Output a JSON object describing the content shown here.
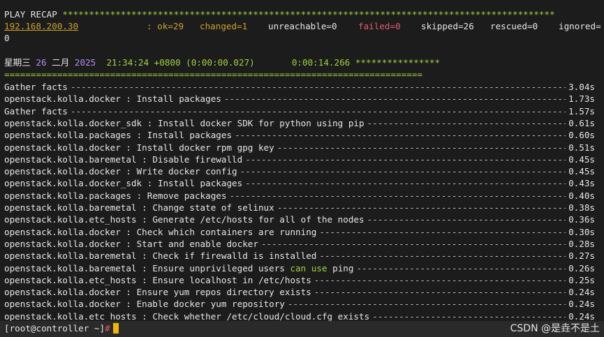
{
  "recap": {
    "title": "PLAY RECAP ",
    "stars": "*********************************************************************************************",
    "host": "192.168.200.30",
    "ok": "ok=29",
    "changed": "changed=1",
    "unreachable": "unreachable=0",
    "failed": "failed=0",
    "skipped": "skipped=26",
    "rescued": "rescued=0",
    "ignored": "ignored=",
    "ignored_wrap": "0"
  },
  "timestamp": {
    "weekday": "星期三",
    "day": "26",
    "month": "二月",
    "year": "2025",
    "time": "21:34:24 +0800 (0:00:00.027)",
    "elapsed": "0:00:14.266",
    "stars": "****************",
    "separator": "==============================================================================="
  },
  "tasks": [
    {
      "role": "Gather facts",
      "name": "",
      "duration": "3.04s"
    },
    {
      "role": "openstack.kolla.docker",
      "name": "Install packages",
      "duration": "1.73s"
    },
    {
      "role": "Gather facts",
      "name": "",
      "duration": "1.57s"
    },
    {
      "role": "openstack.kolla.docker_sdk",
      "name": "Install docker SDK for python using pip",
      "duration": "0.61s"
    },
    {
      "role": "openstack.kolla.packages",
      "name": "Install packages",
      "duration": "0.60s"
    },
    {
      "role": "openstack.kolla.docker",
      "name": "Install docker rpm gpg key",
      "duration": "0.51s"
    },
    {
      "role": "openstack.kolla.baremetal",
      "name": "Disable firewalld",
      "duration": "0.45s"
    },
    {
      "role": "openstack.kolla.docker",
      "name": "Write docker config",
      "duration": "0.45s"
    },
    {
      "role": "openstack.kolla.docker_sdk",
      "name": "Install packages",
      "duration": "0.43s"
    },
    {
      "role": "openstack.kolla.packages",
      "name": "Remove packages",
      "duration": "0.40s"
    },
    {
      "role": "openstack.kolla.baremetal",
      "name": "Change state of selinux",
      "duration": "0.38s"
    },
    {
      "role": "openstack.kolla.etc_hosts",
      "name": "Generate /etc/hosts for all of the nodes",
      "duration": "0.36s"
    },
    {
      "role": "openstack.kolla.docker",
      "name": "Check which containers are running",
      "duration": "0.30s"
    },
    {
      "role": "openstack.kolla.docker",
      "name": "Start and enable docker",
      "duration": "0.28s"
    },
    {
      "role": "openstack.kolla.baremetal",
      "name": "Check if firewalld is installed",
      "duration": "0.27s"
    },
    {
      "role": "openstack.kolla.baremetal",
      "name": "Ensure unprivileged users ",
      "highlight": "can use",
      "name_tail": " ping",
      "duration": "0.26s"
    },
    {
      "role": "openstack.kolla.etc_hosts",
      "name": "Ensure localhost in /etc/hosts",
      "duration": "0.25s"
    },
    {
      "role": "openstack.kolla.docker",
      "name": "Ensure yum repos directory exists",
      "duration": "0.24s"
    },
    {
      "role": "openstack.kolla.docker",
      "name": "Enable docker yum repository",
      "duration": "0.24s"
    },
    {
      "role": "openstack.kolla.etc_hosts",
      "name": "Check whether /etc/cloud/cloud.cfg exists",
      "duration": "0.24s"
    }
  ],
  "prompt": {
    "text": "[root@controller ~]",
    "hash": "#"
  },
  "watermark": "CSDN @是垚不是土",
  "colors": {
    "background": "#1c1c1c",
    "green": "#9fd33a",
    "yellow": "#c9a227",
    "red": "#e35b6e",
    "purple": "#b58cf0",
    "cursor": "#f2b705"
  }
}
